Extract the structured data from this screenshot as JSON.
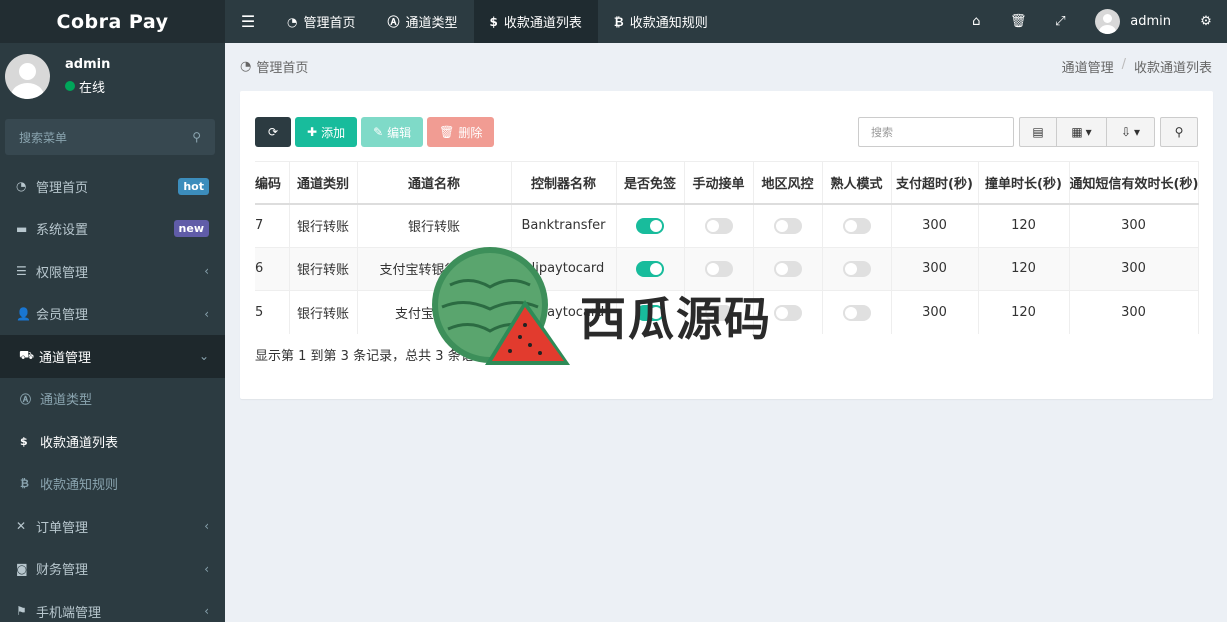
{
  "logo": {
    "text": "Cobra Pay"
  },
  "topnav": {
    "items": [
      {
        "label": "管理首页",
        "icon": "dashboard-icon"
      },
      {
        "label": "通道类型",
        "icon": "a-icon"
      },
      {
        "label": "收款通道列表",
        "icon": "money-icon"
      },
      {
        "label": "收款通知规则",
        "icon": "bitcoin-icon"
      }
    ],
    "username": "admin"
  },
  "sidebar": {
    "user": {
      "name": "admin",
      "status": "在线"
    },
    "search_placeholder": "搜索菜单",
    "items": [
      {
        "label": "管理首页",
        "badge": "hot"
      },
      {
        "label": "系统设置",
        "badge": "new"
      },
      {
        "label": "权限管理"
      },
      {
        "label": "会员管理"
      },
      {
        "label": "通道管理"
      },
      {
        "label": "订单管理"
      },
      {
        "label": "财务管理"
      },
      {
        "label": "手机端管理"
      }
    ],
    "subitems": [
      {
        "label": "通道类型"
      },
      {
        "label": "收款通道列表"
      },
      {
        "label": "收款通知规则"
      }
    ],
    "badge_colors": {
      "hot": "#3c8dbc",
      "new": "#605ca8"
    }
  },
  "content": {
    "home_label": "管理首页",
    "breadcrumb": [
      "通道管理",
      "收款通道列表"
    ],
    "toolbar": {
      "add": "添加",
      "edit": "编辑",
      "delete": "删除"
    },
    "search_placeholder": "搜索",
    "table": {
      "headers": [
        "编码",
        "通道类别",
        "通道名称",
        "控制器名称",
        "是否免签",
        "手动接单",
        "地区风控",
        "熟人模式",
        "支付超时(秒)",
        "撞单时长(秒)",
        "通知短信有效时长(秒)"
      ],
      "rows": [
        {
          "id": "7",
          "category": "银行转账",
          "name": "银行转账",
          "controller": "Banktransfer",
          "mianqian": true,
          "manual": false,
          "region": false,
          "acquaintance": false,
          "timeout": "300",
          "collision": "120",
          "sms": "300"
        },
        {
          "id": "6",
          "category": "银行转账",
          "name": "支付宝转银行卡[加",
          "controller": "Alipaytocard",
          "mianqian": true,
          "manual": false,
          "region": false,
          "acquaintance": false,
          "timeout": "300",
          "collision": "120",
          "sms": "300"
        },
        {
          "id": "5",
          "category": "银行转账",
          "name": "支付宝转银行",
          "controller": "Alipaytocard",
          "mianqian": true,
          "manual": false,
          "region": false,
          "acquaintance": false,
          "timeout": "300",
          "collision": "120",
          "sms": "300"
        }
      ]
    },
    "footer_info": "显示第 1 到第 3 条记录，总共 3 条记录"
  },
  "watermark": {
    "text": "西瓜源码"
  },
  "colors": {
    "accent": "#18bc9c",
    "sidebar": "#2c3b41",
    "danger": "#e74c3c"
  }
}
